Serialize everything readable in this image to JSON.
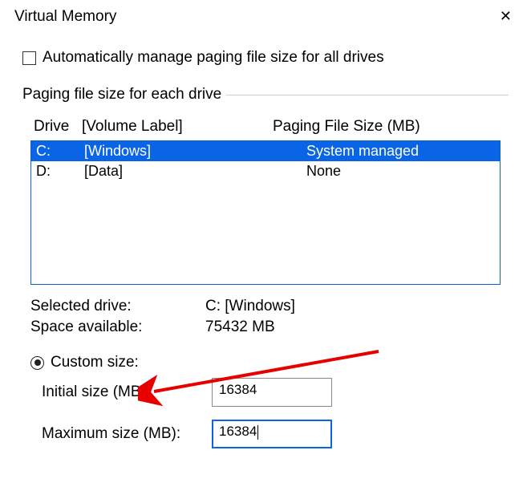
{
  "window": {
    "title": "Virtual Memory"
  },
  "automanage": {
    "label": "Automatically manage paging file size for all drives",
    "checked": false
  },
  "group": {
    "legend": "Paging file size for each drive",
    "header_drive": "Drive",
    "header_label": "[Volume Label]",
    "header_size": "Paging File Size (MB)",
    "drives": [
      {
        "letter": "C:",
        "label": "[Windows]",
        "size": "System managed",
        "selected": true
      },
      {
        "letter": "D:",
        "label": "[Data]",
        "size": "None",
        "selected": false
      }
    ],
    "selected_drive_label": "Selected drive:",
    "selected_drive_value": "C:   [Windows]",
    "space_avail_label": "Space available:",
    "space_avail_value": "75432 MB"
  },
  "custom": {
    "radio_label": "Custom size:",
    "checked": true,
    "initial_label": "Initial size (MB):",
    "initial_value": "16384",
    "maximum_label": "Maximum size (MB):",
    "maximum_value": "16384"
  }
}
